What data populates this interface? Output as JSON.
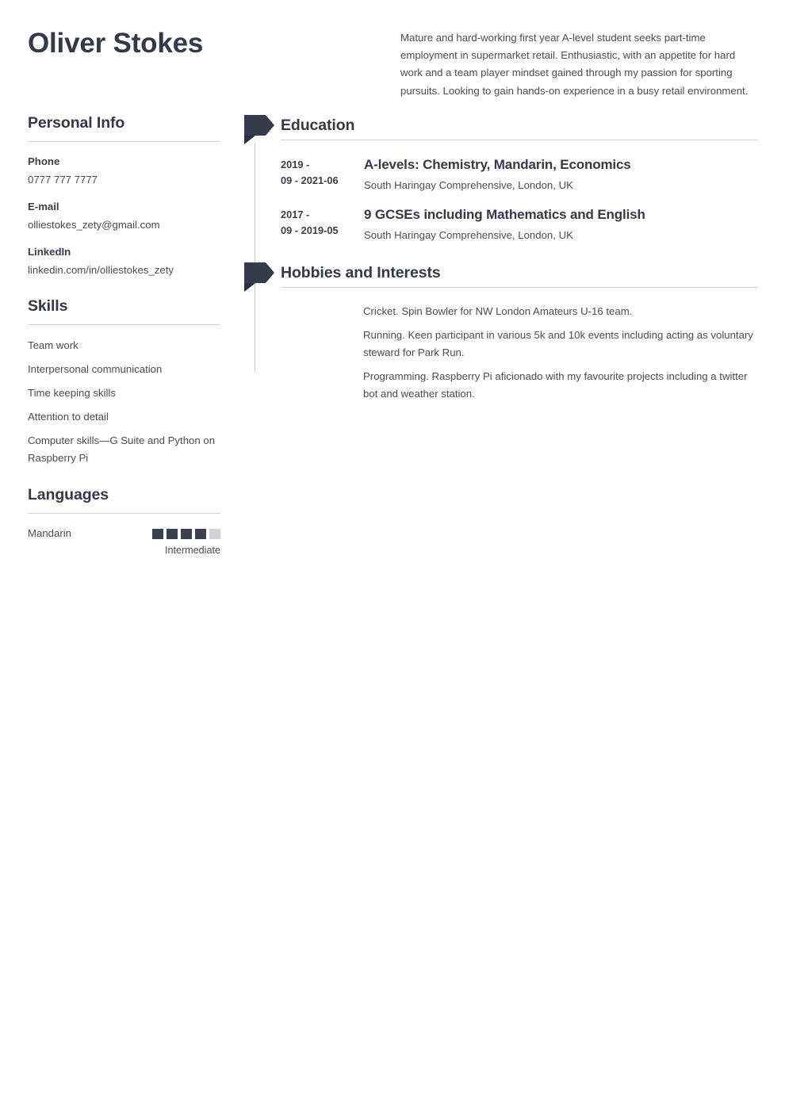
{
  "header": {
    "name": "Oliver Stokes",
    "summary": "Mature and hard-working first year A-level student seeks part-time employment in supermarket retail. Enthusiastic, with an appetite for hard work and a team player mindset gained through my passion for sporting pursuits. Looking to gain hands-on experience in a busy retail environment."
  },
  "colors": {
    "accent_dark": "#353b4a",
    "fold_dark": "#2a2f3c",
    "heading": "#333948",
    "body_text": "#4d4d4d",
    "rule": "#d3d3d3",
    "meter_empty": "#d3d3d3",
    "meter_filled": "#3a4050"
  },
  "sidebar": {
    "personal_info": {
      "heading": "Personal Info",
      "items": [
        {
          "label": "Phone",
          "value": "0777 777 7777"
        },
        {
          "label": "E-mail",
          "value": "olliestokes_zety@gmail.com"
        },
        {
          "label": "LinkedIn",
          "value": "linkedin.com/in/olliestokes_zety"
        }
      ]
    },
    "skills": {
      "heading": "Skills",
      "items": [
        "Team work",
        "Interpersonal communication",
        "Time keeping skills",
        "Attention to detail",
        "Computer skills—G Suite and Python on Raspberry Pi"
      ]
    },
    "languages": {
      "heading": "Languages",
      "items": [
        {
          "name": "Mandarin",
          "level_label": "Intermediate",
          "filled": 4,
          "total": 5
        }
      ]
    }
  },
  "main": {
    "education": {
      "heading": "Education",
      "marker": "ribbon-marker",
      "entries": [
        {
          "date": "2019-09 - 2021-06",
          "title": "A-levels: Chemistry, Mandarin, Economics",
          "subtitle": "South Haringay Comprehensive, London, UK"
        },
        {
          "date": "2017-09 - 2019-05",
          "title": "9 GCSEs including Mathematics and English",
          "subtitle": "South Haringay Comprehensive, London, UK"
        }
      ]
    },
    "hobbies": {
      "heading": "Hobbies and Interests",
      "marker": "ribbon-marker",
      "items": [
        "Cricket. Spin Bowler for NW London Amateurs U-16 team.",
        "Running. Keen participant in various 5k and 10k events including acting as voluntary steward for Park Run.",
        "Programming. Raspberry Pi aficionado with my favourite projects including a twitter bot and weather station."
      ]
    }
  }
}
